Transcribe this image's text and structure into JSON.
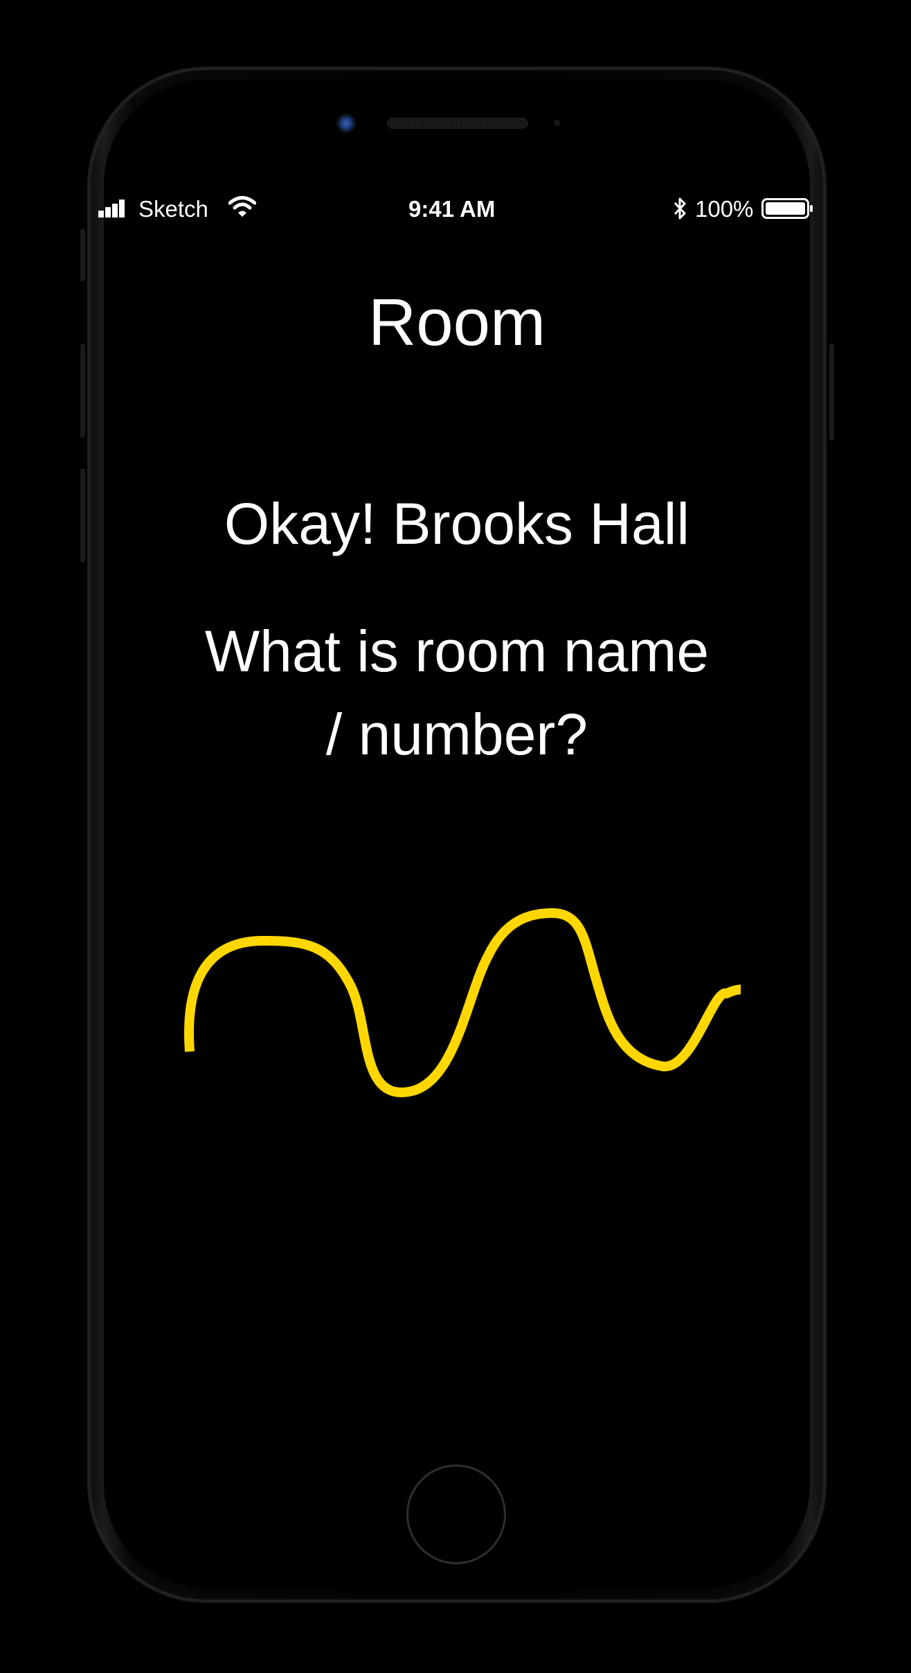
{
  "status_bar": {
    "carrier": "Sketch",
    "time": "9:41 AM",
    "battery": "100%",
    "icons": [
      "signal-bars-icon",
      "wifi-icon",
      "bluetooth-icon",
      "battery-icon"
    ]
  },
  "screen": {
    "title": "Room",
    "confirmation": "Okay! Brooks Hall",
    "question_line1": "What is room name",
    "question_line2": "/ number?",
    "voice_wave_icon": "voice-waveform-icon"
  },
  "colors": {
    "background": "#000000",
    "text": "#ffffff",
    "accent": "#FFD700"
  }
}
